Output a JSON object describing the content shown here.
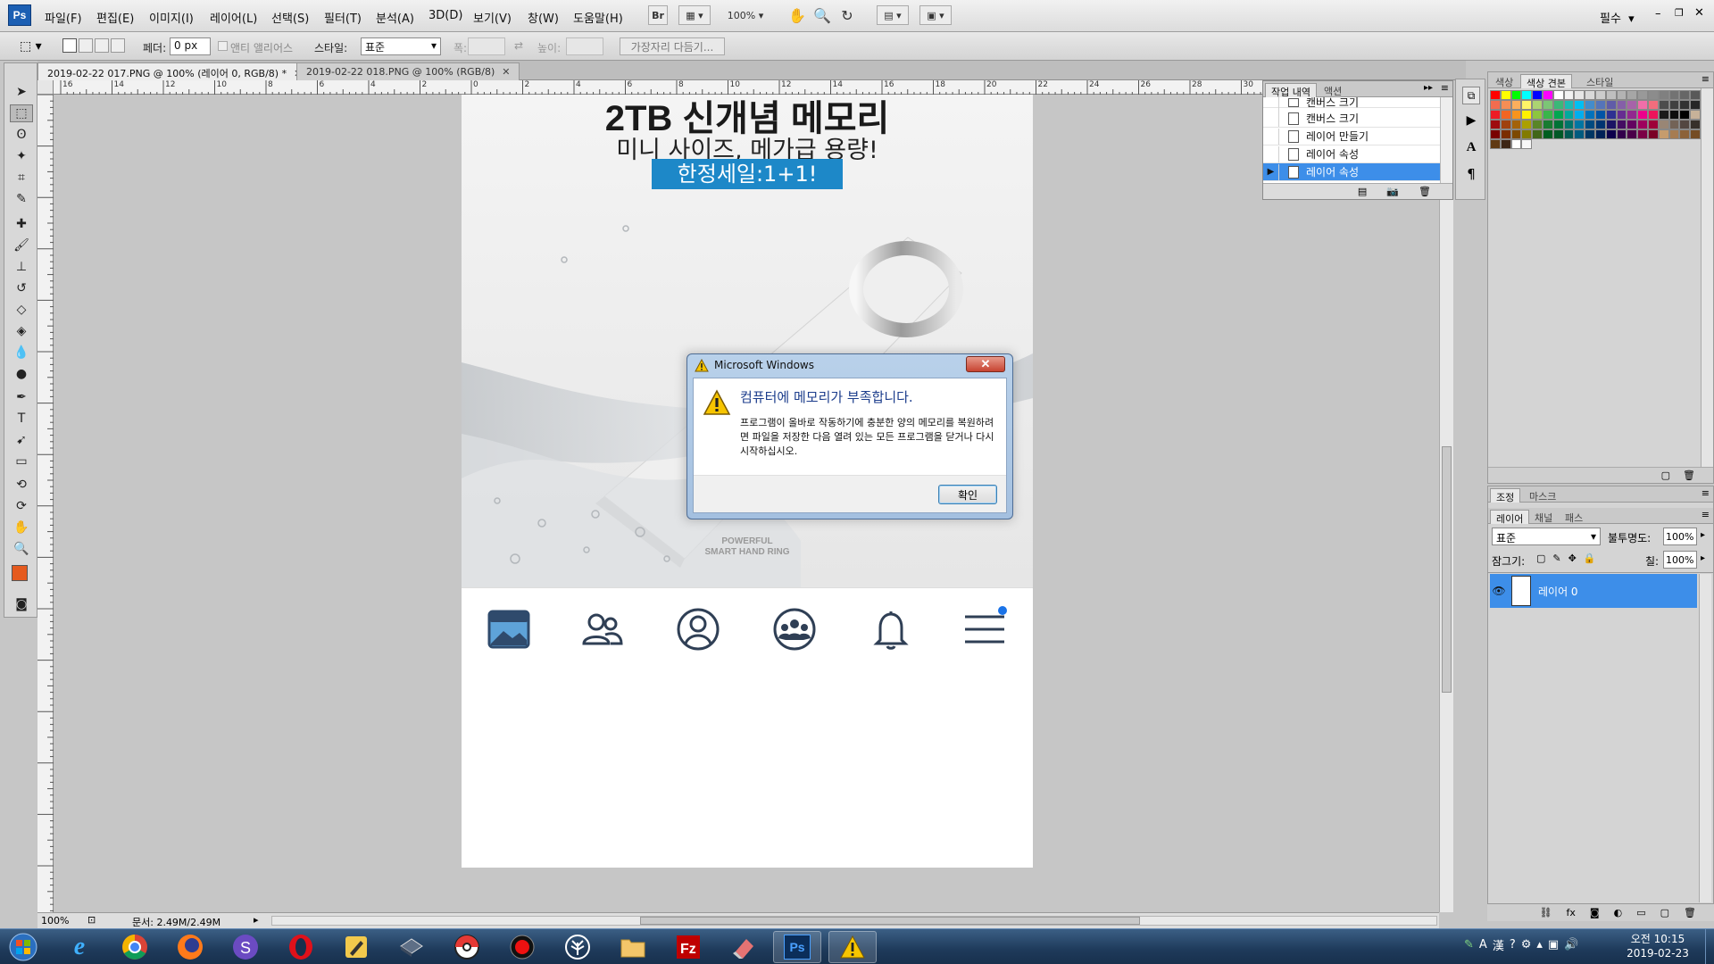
{
  "app": {
    "logo": "Ps"
  },
  "menu": [
    "파일(F)",
    "편집(E)",
    "이미지(I)",
    "레이어(L)",
    "선택(S)",
    "필터(T)",
    "분석(A)",
    "3D(D)",
    "보기(V)",
    "창(W)",
    "도움말(H)"
  ],
  "toolbar": {
    "zoom": "100%",
    "workspace": "필수",
    "bridge_label": "Br"
  },
  "options": {
    "feather_label": "페더:",
    "feather_value": "0 px",
    "antialias_label": "앤티 앨리어스",
    "style_label": "스타일:",
    "style_value": "표준",
    "width_label": "폭:",
    "height_label": "높이:",
    "refine_label": "가장자리 다듬기..."
  },
  "tabs": [
    {
      "label": "2019-02-22 017.PNG @ 100% (레이어 0, RGB/8) *",
      "active": true
    },
    {
      "label": "2019-02-22 018.PNG @ 100% (RGB/8)",
      "active": false
    }
  ],
  "ruler": {
    "h": [
      "16",
      "14",
      "12",
      "10",
      "8",
      "6",
      "4",
      "2",
      "0",
      "2",
      "4",
      "6",
      "8",
      "10",
      "12",
      "14",
      "16",
      "18",
      "20",
      "22",
      "24",
      "26",
      "28",
      "30"
    ]
  },
  "canvas": {
    "title": "2TB 신개념 메모리",
    "subtitle": "미니 사이즈, 메가급 용량!",
    "sale": "한정세일:1+1!",
    "product_line1": "POWERFUL",
    "product_line2": "SMART HAND RING"
  },
  "nav_icons": [
    "gallery-icon",
    "friends-icon",
    "profile-icon",
    "group-icon",
    "bell-icon",
    "menu-icon"
  ],
  "dialog": {
    "title": "Microsoft Windows",
    "close": "✕",
    "heading": "컴퓨터에 메모리가 부족합니다.",
    "message": "프로그램이 올바로 작동하기에 충분한 양의 메모리를 복원하려면 파일을 저장한 다음 열려 있는 모든 프로그램을 닫거나 다시 시작하십시오.",
    "ok": "확인"
  },
  "history": {
    "tabs": [
      "작업 내역",
      "액션"
    ],
    "items": [
      "캔버스 크기",
      "캔버스 크기",
      "레이어 만들기",
      "레이어 속성",
      "레이어 속성"
    ],
    "selected_index": 4
  },
  "swatches": {
    "tabs": [
      "색상",
      "색상 견본",
      "스타일"
    ],
    "colors": [
      "#ff0000",
      "#ffff00",
      "#00ff00",
      "#00ffff",
      "#0000ff",
      "#ff00ff",
      "#ffffff",
      "#f2f2f2",
      "#e6e6e6",
      "#d9d9d9",
      "#cccccc",
      "#bfbfbf",
      "#b3b3b3",
      "#a6a6a6",
      "#999999",
      "#8c8c8c",
      "#808080",
      "#737373",
      "#666666",
      "#595959",
      "#f26c4f",
      "#f68e55",
      "#fbaf5c",
      "#fff467",
      "#acd372",
      "#7cc576",
      "#3bb878",
      "#1abbb4",
      "#00bff3",
      "#438ccb",
      "#5574b9",
      "#605ca8",
      "#855fa8",
      "#a763a9",
      "#f06ea9",
      "#f26d7d",
      "#4d4d4d",
      "#404040",
      "#333333",
      "#262626",
      "#ed1c24",
      "#f26522",
      "#f7941d",
      "#fff200",
      "#8dc63f",
      "#39b54a",
      "#00a651",
      "#00a99d",
      "#00aeef",
      "#0072bc",
      "#0054a6",
      "#2e3192",
      "#662d91",
      "#92278f",
      "#ec008c",
      "#ed145b",
      "#1a1a1a",
      "#0d0d0d",
      "#000000",
      "#c7b299",
      "#9e0b0f",
      "#a0410d",
      "#a3620a",
      "#aba000",
      "#598527",
      "#197b30",
      "#007236",
      "#00746b",
      "#0076a3",
      "#004a80",
      "#003471",
      "#1b1464",
      "#440e62",
      "#630460",
      "#9e005d",
      "#9e0039",
      "#998675",
      "#736357",
      "#534741",
      "#37302a",
      "#790000",
      "#7b2e00",
      "#7d4900",
      "#827b00",
      "#406618",
      "#005e20",
      "#005826",
      "#005952",
      "#005b7f",
      "#003663",
      "#002157",
      "#0d004c",
      "#32004b",
      "#4b0049",
      "#7b0046",
      "#7a0026",
      "#c69c6d",
      "#a67c52",
      "#8c6239",
      "#754c24",
      "#603913",
      "#3c2415",
      "#ffffff",
      "#f7f7f7"
    ]
  },
  "layers": {
    "tabs_top": [
      "조정",
      "마스크"
    ],
    "tabs": [
      "레이어",
      "채널",
      "패스"
    ],
    "blend_mode": "표준",
    "opacity_label": "불투명도:",
    "opacity": "100%",
    "lock_label": "잠그기:",
    "fill_label": "칠:",
    "fill": "100%",
    "layer_name": "레이어 0"
  },
  "status": {
    "zoom": "100%",
    "doc": "문서: 2.49M/2.49M"
  },
  "taskbar": {
    "apps": [
      "start-orb-icon",
      "ie-icon",
      "chrome-icon",
      "firefox-icon",
      "s-app-icon",
      "opera-icon",
      "pen-app-icon",
      "book-app-icon",
      "pokeball-app-icon",
      "record-app-icon",
      "tree-app-icon",
      "folder-icon",
      "filezilla-icon",
      "eraser-app-icon",
      "photoshop-icon",
      "warning-icon"
    ],
    "ps_label": "Ps",
    "fz_label": "Fz",
    "lang_a": "A",
    "lang_han": "漢",
    "time": "오전 10:15",
    "date": "2019-02-23"
  }
}
